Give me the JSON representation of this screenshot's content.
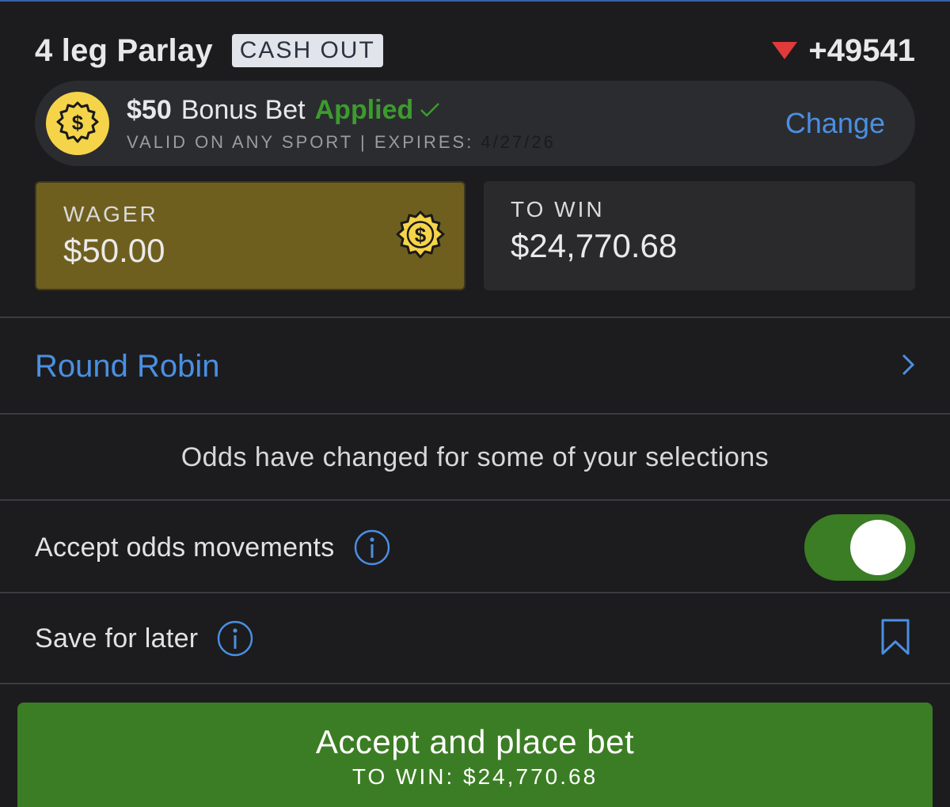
{
  "header": {
    "title": "4 leg Parlay",
    "badge": "CASH OUT",
    "odds": "+49541",
    "odds_trend": "down"
  },
  "bonus": {
    "amount": "$50",
    "label": "Bonus Bet",
    "status": "Applied",
    "detail": "VALID ON ANY SPORT | EXPIRES: ",
    "expiry": "4/27/26",
    "change_label": "Change"
  },
  "wager": {
    "label": "WAGER",
    "value": "$50.00"
  },
  "to_win": {
    "label": "TO WIN",
    "value": "$24,770.68"
  },
  "round_robin": {
    "label": "Round Robin"
  },
  "notice": "Odds have changed for some of your selections",
  "options": {
    "accept_odds_label": "Accept odds movements",
    "accept_odds_enabled": true,
    "save_later_label": "Save for later"
  },
  "cta": {
    "label": "Accept and place bet",
    "sub": "TO WIN: $24,770.68"
  },
  "colors": {
    "accent_blue": "#4a8fe2",
    "success_green": "#3b7d24",
    "coin_yellow": "#f5d44a",
    "wager_gold": "#6f5f1f",
    "odds_down_red": "#e03a3a"
  },
  "icons": [
    "down-triangle-icon",
    "dollar-coin-icon",
    "checkmark-icon",
    "chevron-right-icon",
    "info-icon",
    "bookmark-icon"
  ]
}
